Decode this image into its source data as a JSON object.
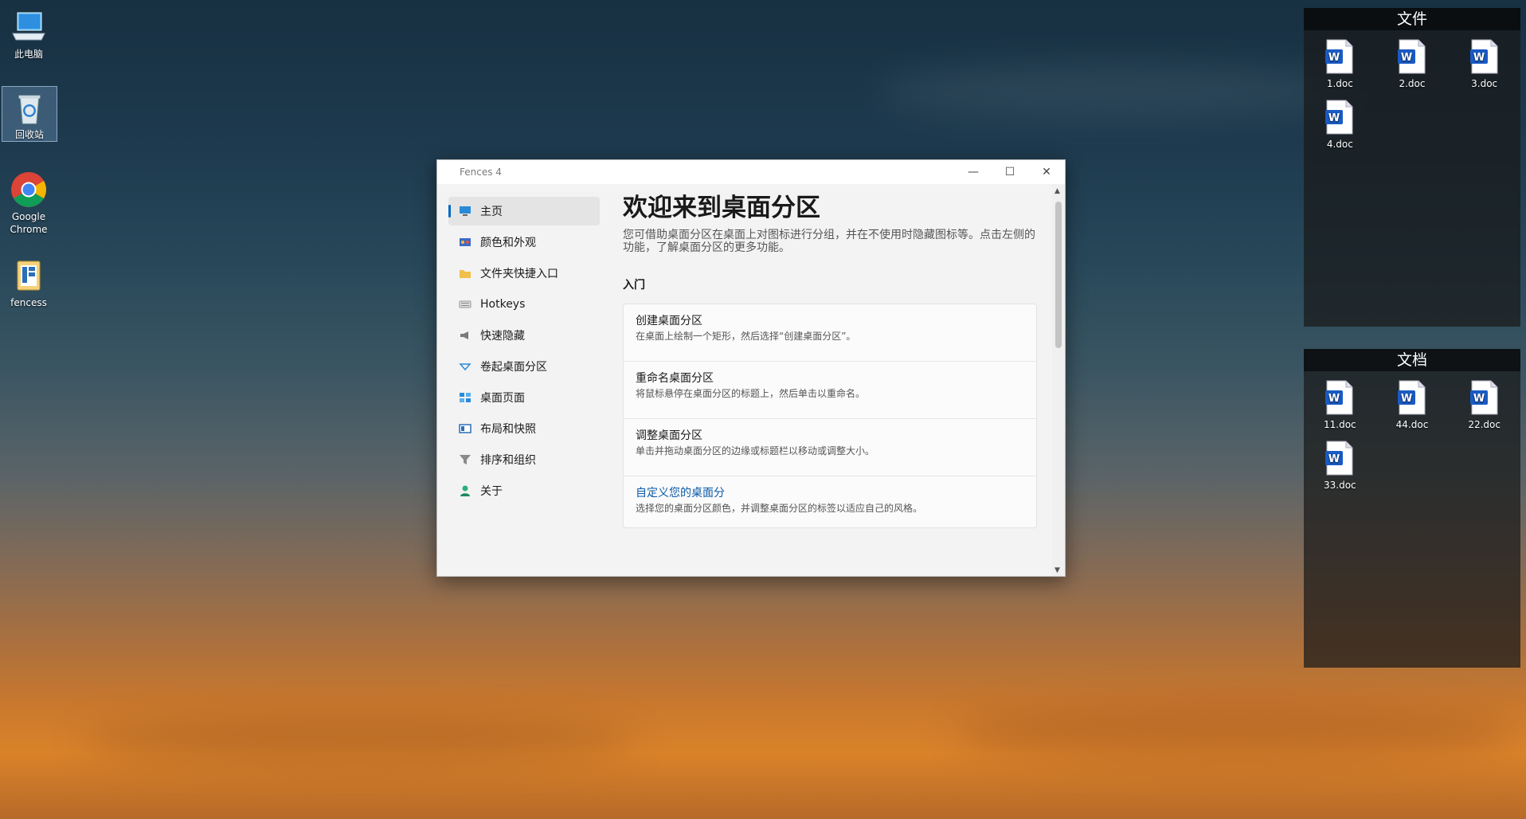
{
  "desktop": {
    "icons": [
      {
        "label": "此电脑",
        "icon": "computer-icon"
      },
      {
        "label": "回收站",
        "icon": "recycle-bin-icon"
      },
      {
        "label": "Google Chrome",
        "icon": "chrome-icon"
      },
      {
        "label": "fencess",
        "icon": "fences-icon"
      }
    ]
  },
  "fences": [
    {
      "title": "文件",
      "files": [
        "1.doc",
        "2.doc",
        "3.doc",
        "4.doc"
      ]
    },
    {
      "title": "文档",
      "files": [
        "11.doc",
        "44.doc",
        "22.doc",
        "33.doc"
      ]
    }
  ],
  "window": {
    "title": "Fences 4",
    "controls": {
      "minimize": "—",
      "maximize": "☐",
      "close": "✕"
    },
    "nav": [
      {
        "label": "主页",
        "icon": "monitor-icon",
        "active": true
      },
      {
        "label": "颜色和外观",
        "icon": "palette-icon"
      },
      {
        "label": "文件夹快捷入口",
        "icon": "folder-icon"
      },
      {
        "label": "Hotkeys",
        "icon": "keyboard-icon"
      },
      {
        "label": "快速隐藏",
        "icon": "megaphone-icon"
      },
      {
        "label": "卷起桌面分区",
        "icon": "rollup-icon"
      },
      {
        "label": "桌面页面",
        "icon": "pages-icon"
      },
      {
        "label": "布局和快照",
        "icon": "layout-icon"
      },
      {
        "label": "排序和组织",
        "icon": "filter-icon"
      },
      {
        "label": "关于",
        "icon": "person-icon"
      }
    ],
    "content": {
      "title": "欢迎来到桌面分区",
      "description": "您可借助桌面分区在桌面上对图标进行分组，并在不使用时隐藏图标等。点击左侧的功能，了解桌面分区的更多功能。",
      "section": "入门",
      "cards": [
        {
          "title": "创建桌面分区",
          "subtitle": "在桌面上绘制一个矩形，然后选择“创建桌面分区”。"
        },
        {
          "title": "重命名桌面分区",
          "subtitle": "将鼠标悬停在桌面分区的标题上，然后单击以重命名。"
        },
        {
          "title": "调整桌面分区",
          "subtitle": "单击并拖动桌面分区的边缘或标题栏以移动或调整大小。"
        },
        {
          "title": "自定义您的桌面分",
          "subtitle": "选择您的桌面分区颜色，并调整桌面分区的标签以适应自己的风格。",
          "link": true
        }
      ]
    }
  },
  "colors": {
    "accent": "#0067c0",
    "link": "#0a5aa8",
    "word_blue": "#1a5bc4"
  }
}
